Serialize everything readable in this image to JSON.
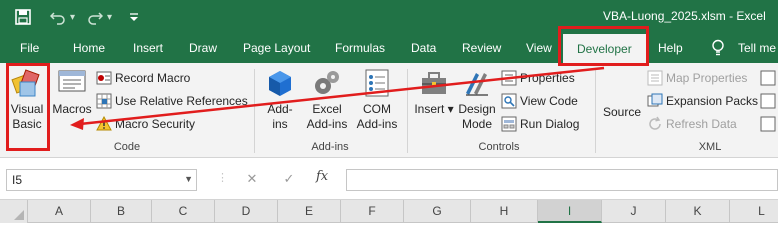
{
  "titlebar": {
    "title": "VBA-Luong_2025.xlsm  -  Excel",
    "save_icon": "save-icon",
    "undo_icon": "undo-icon",
    "redo_icon": "redo-icon",
    "customize_icon": "customize-qat-icon"
  },
  "tabs": [
    {
      "label": "File"
    },
    {
      "label": "Home"
    },
    {
      "label": "Insert"
    },
    {
      "label": "Draw"
    },
    {
      "label": "Page Layout"
    },
    {
      "label": "Formulas"
    },
    {
      "label": "Data"
    },
    {
      "label": "Review"
    },
    {
      "label": "View"
    },
    {
      "label": "Developer",
      "active": true
    },
    {
      "label": "Help"
    },
    {
      "label": "Tell me"
    }
  ],
  "ribbon": {
    "code": {
      "group_label": "Code",
      "visual_basic_line1": "Visual",
      "visual_basic_line2": "Basic",
      "macros": "Macros",
      "record_macro": "Record Macro",
      "relative_refs": "Use Relative References",
      "macro_security": "Macro Security"
    },
    "addins": {
      "group_label": "Add-ins",
      "addins_line1": "Add-",
      "addins_line2": "ins",
      "excel_addins_line1": "Excel",
      "excel_addins_line2": "Add-ins",
      "com_addins_line1": "COM",
      "com_addins_line2": "Add-ins"
    },
    "controls": {
      "group_label": "Controls",
      "insert": "Insert",
      "design_mode_line1": "Design",
      "design_mode_line2": "Mode",
      "properties": "Properties",
      "view_code": "View Code",
      "run_dialog": "Run Dialog"
    },
    "xml": {
      "group_label": "XML",
      "source": "Source",
      "map_properties": "Map Properties",
      "expansion_packs": "Expansion Packs",
      "refresh_data": "Refresh Data"
    }
  },
  "formula_bar": {
    "name_box": "I5",
    "fx": "fx",
    "formula": ""
  },
  "columns": [
    "A",
    "B",
    "C",
    "D",
    "E",
    "F",
    "G",
    "H",
    "I",
    "J",
    "K",
    "L"
  ],
  "selected_column": "I",
  "colors": {
    "brand": "#217346",
    "annotation": "#e11d1d"
  }
}
